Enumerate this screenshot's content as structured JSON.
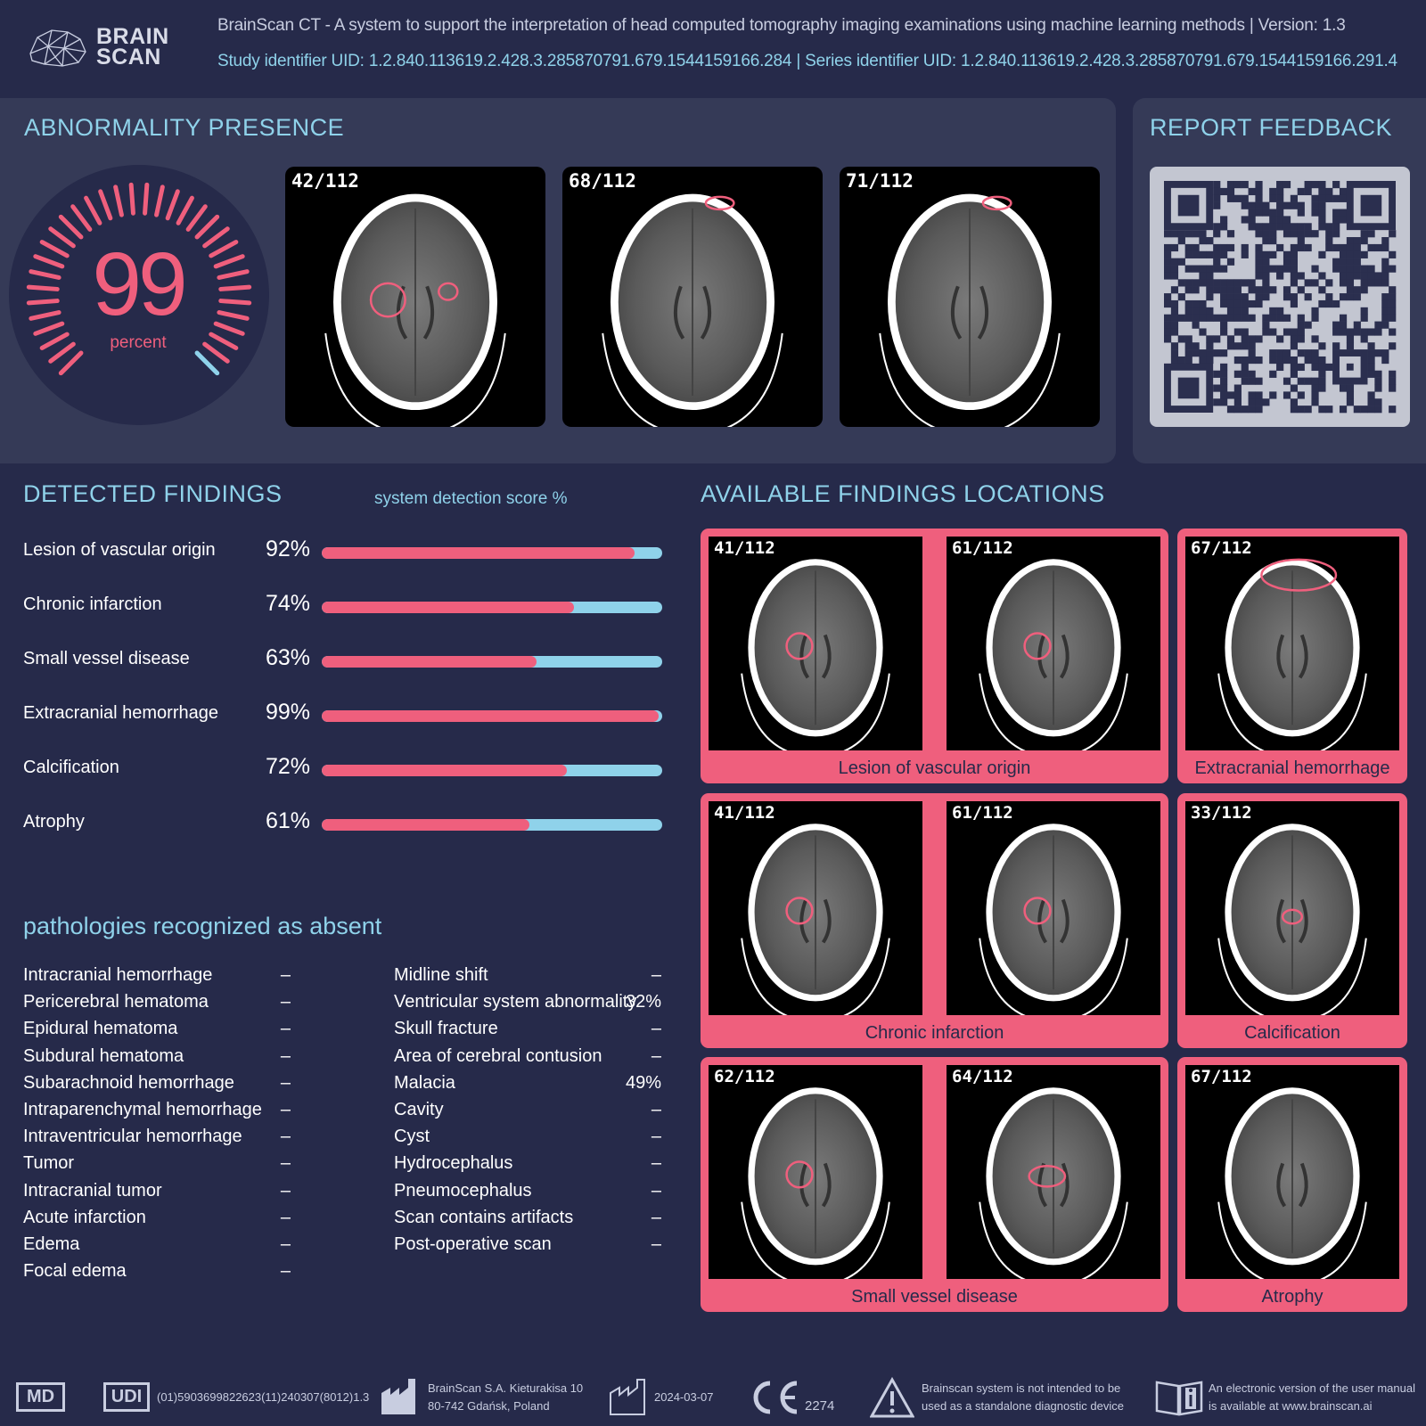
{
  "header": {
    "logo_line1": "BRAIN",
    "logo_line2": "SCAN",
    "line1": "BrainScan CT - A system to support the interpretation of head computed tomography imaging examinations using machine learning methods  |  Version: 1.3",
    "line2": "Study identifier UID: 1.2.840.113619.2.428.3.285870791.679.1544159166.284  |  Series identifier UID: 1.2.840.113619.2.428.3.285870791.679.1544159166.291.4"
  },
  "abnormality": {
    "title": "ABNORMALITY PRESENCE",
    "value": "99",
    "unit": "percent",
    "level": 0.99,
    "slices": [
      "42/112",
      "68/112",
      "71/112"
    ]
  },
  "feedback": {
    "title": "REPORT FEEDBACK"
  },
  "findings": {
    "title": "DETECTED FINDINGS",
    "score_header": "system detection score %",
    "items": [
      {
        "label": "Lesion of vascular origin",
        "pct": "92%",
        "value": 92
      },
      {
        "label": "Chronic infarction",
        "pct": "74%",
        "value": 74
      },
      {
        "label": "Small vessel disease",
        "pct": "63%",
        "value": 63
      },
      {
        "label": "Extracranial hemorrhage",
        "pct": "99%",
        "value": 99
      },
      {
        "label": "Calcification",
        "pct": "72%",
        "value": 72
      },
      {
        "label": "Atrophy",
        "pct": "61%",
        "value": 61
      }
    ]
  },
  "absent": {
    "title": "pathologies recognized as absent",
    "left": [
      {
        "label": "Intracranial hemorrhage",
        "value": "–"
      },
      {
        "label": "Pericerebral hematoma",
        "value": "–"
      },
      {
        "label": "Epidural hematoma",
        "value": "–"
      },
      {
        "label": "Subdural hematoma",
        "value": "–"
      },
      {
        "label": "Subarachnoid hemorrhage",
        "value": "–"
      },
      {
        "label": "Intraparenchymal hemorrhage",
        "value": "–"
      },
      {
        "label": "Intraventricular hemorrhage",
        "value": "–"
      },
      {
        "label": "Tumor",
        "value": "–"
      },
      {
        "label": "Intracranial tumor",
        "value": "–"
      },
      {
        "label": "Acute infarction",
        "value": "–"
      },
      {
        "label": "Edema",
        "value": "–"
      },
      {
        "label": "Focal edema",
        "value": "–"
      }
    ],
    "right": [
      {
        "label": "Midline shift",
        "value": "–"
      },
      {
        "label": "Ventricular system abnormality",
        "value": "32%"
      },
      {
        "label": "Skull fracture",
        "value": "–"
      },
      {
        "label": "Area of cerebral contusion",
        "value": "–"
      },
      {
        "label": "Malacia",
        "value": "49%"
      },
      {
        "label": "Cavity",
        "value": "–"
      },
      {
        "label": "Cyst",
        "value": "–"
      },
      {
        "label": "Hydrocephalus",
        "value": "–"
      },
      {
        "label": "Pneumocephalus",
        "value": "–"
      },
      {
        "label": "Scan contains artifacts",
        "value": "–"
      },
      {
        "label": "Post-operative scan",
        "value": "–"
      }
    ]
  },
  "locations": {
    "title": "AVAILABLE FINDINGS LOCATIONS",
    "cards": [
      {
        "caption": "Lesion of vascular origin",
        "slices": [
          "41/112",
          "61/112"
        ]
      },
      {
        "caption": "Extracranial hemorrhage",
        "slices": [
          "67/112"
        ]
      },
      {
        "caption": "Chronic infarction",
        "slices": [
          "41/112",
          "61/112"
        ]
      },
      {
        "caption": "Calcification",
        "slices": [
          "33/112"
        ]
      },
      {
        "caption": "Small vessel disease",
        "slices": [
          "62/112",
          "64/112"
        ]
      },
      {
        "caption": "Atrophy",
        "slices": [
          "67/112"
        ]
      }
    ]
  },
  "footer": {
    "md": "MD",
    "udi": "UDI",
    "udi_code": "(01)5903699822623(11)240307(8012)1.3",
    "manufacturer_line1": "BrainScan S.A. Kieturakisa 10",
    "manufacturer_line2": "80-742 Gdańsk, Poland",
    "date": "2024-03-07",
    "ce_number": "2274",
    "warning_line1": "Brainscan system is not intended to be",
    "warning_line2": "used as a standalone diagnostic device",
    "manual_line1": "An electronic version of the user manual",
    "manual_line2": "is available at www.brainscan.ai"
  },
  "colors": {
    "background": "#262a4a",
    "panel": "#353a57",
    "accent_pink": "#ef5f7d",
    "accent_blue": "#8fd2ea"
  }
}
